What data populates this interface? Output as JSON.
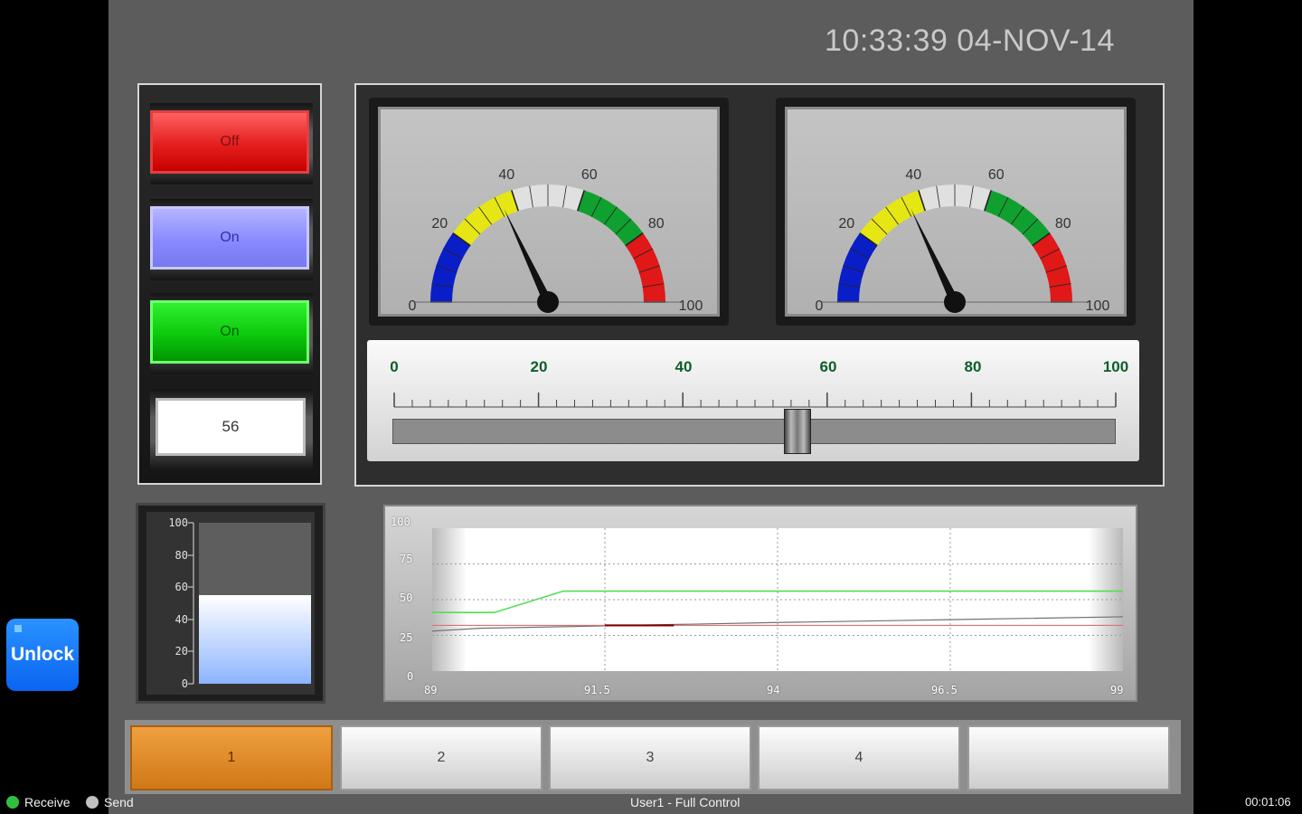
{
  "clock": {
    "text": "10:33:39 04-NOV-14"
  },
  "buttons": {
    "off_label": "Off",
    "on1_label": "On",
    "on2_label": "On",
    "display_value": "56"
  },
  "gauges": [
    {
      "value": 36,
      "min": 0,
      "max": 100,
      "ticks": [
        "0",
        "20",
        "40",
        "60",
        "80",
        "100"
      ]
    },
    {
      "value": 36,
      "min": 0,
      "max": 100,
      "ticks": [
        "0",
        "20",
        "40",
        "60",
        "80",
        "100"
      ]
    }
  ],
  "gauge_colors": {
    "low": "#0a1ec8",
    "warn": "#e6e614",
    "normal": "#e0e0e0",
    "good": "#10a030",
    "alarm": "#e01818"
  },
  "slider": {
    "value": 56,
    "min": 0,
    "max": 100,
    "labels": [
      "0",
      "20",
      "40",
      "60",
      "80",
      "100"
    ]
  },
  "tank": {
    "level": 55,
    "labels": [
      "100",
      "80",
      "60",
      "40",
      "20",
      "0"
    ]
  },
  "trend": {
    "y_labels": [
      "100",
      "75",
      "50",
      "25",
      "0"
    ],
    "x_labels": [
      "89",
      "91.5",
      "94",
      "96.5",
      "99"
    ],
    "series_colors": [
      "#50e050",
      "#e07070",
      "#7a0000",
      "#707070"
    ]
  },
  "chart_data": {
    "type": "line",
    "ylim": [
      0,
      100
    ],
    "xlim": [
      89,
      99
    ],
    "series": [
      {
        "x": [
          89,
          89.9,
          90.9,
          99
        ],
        "values": [
          41,
          41,
          56,
          56
        ]
      },
      {
        "x": [
          89,
          99
        ],
        "values": [
          32,
          32
        ]
      },
      {
        "x": [
          91.5,
          92.5
        ],
        "values": [
          32,
          32
        ]
      },
      {
        "x": [
          89,
          89.7,
          94,
          96.5,
          99
        ],
        "values": [
          28,
          30,
          34,
          36,
          38
        ]
      }
    ]
  },
  "tabs": [
    {
      "label": "1"
    },
    {
      "label": "2"
    },
    {
      "label": "3"
    },
    {
      "label": "4"
    },
    {
      "label": ""
    }
  ],
  "unlock": {
    "label": "Unlock"
  },
  "status": {
    "receive_label": "Receive",
    "send_label": "Send",
    "user_text": "User1 - Full Control",
    "timer": "00:01:06",
    "receive_led": "#30c040",
    "send_led": "#c0c0c0"
  }
}
